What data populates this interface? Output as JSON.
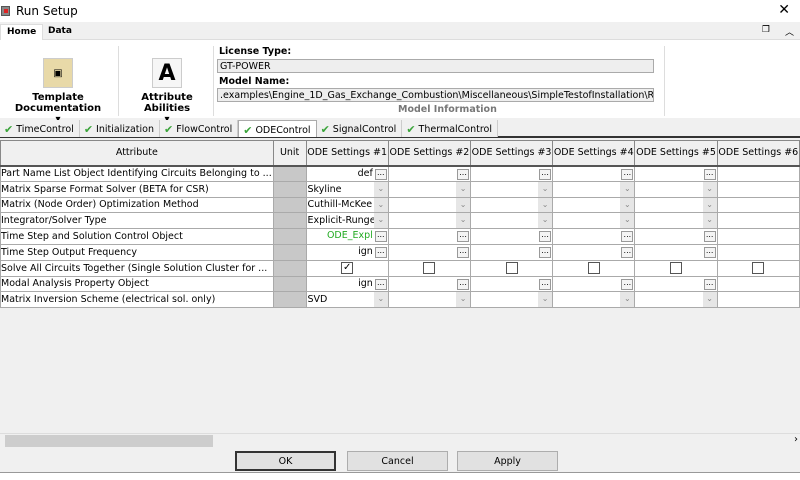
{
  "window": {
    "title": "Run Setup"
  },
  "ribbon": {
    "tabs": [
      "Home",
      "Data"
    ],
    "template_doc": "Template Documentation",
    "attr_abilities": "Attribute Abilities",
    "license_label": "License Type:",
    "license_value": "GT-POWER",
    "model_label": "Model Name:",
    "model_value": ".examples\\Engine_1D_Gas_Exchange_Combustion\\Miscellaneous\\SimpleTestofInstallation\\RunMeFirst.gtm",
    "group_label": "Model Information"
  },
  "tabs": [
    {
      "label": "TimeControl"
    },
    {
      "label": "Initialization"
    },
    {
      "label": "FlowControl"
    },
    {
      "label": "ODEControl",
      "active": true
    },
    {
      "label": "SignalControl"
    },
    {
      "label": "ThermalControl"
    }
  ],
  "accent": "#3aa43a",
  "table": {
    "headers": [
      "Attribute",
      "Unit",
      "ODE Settings #1",
      "ODE Settings #2",
      "ODE Settings #3",
      "ODE Settings #4",
      "ODE Settings #5",
      "ODE Settings #6"
    ],
    "rows": [
      {
        "attribute": "Part Name List Object Identifying Circuits Belonging to ...",
        "type": "object",
        "value": "def"
      },
      {
        "attribute": "Matrix Sparse Format Solver (BETA for CSR)",
        "type": "select",
        "value": "Skyline"
      },
      {
        "attribute": "Matrix (Node Order) Optimization Method",
        "type": "select",
        "value": "Cuthill-McKee"
      },
      {
        "attribute": "Integrator/Solver Type",
        "type": "select",
        "value": "Explicit-Runge..."
      },
      {
        "attribute": "Time Step and Solution Control Object",
        "type": "object",
        "value": "ODE_Expl",
        "value_color": "#22aa22"
      },
      {
        "attribute": "Time Step Output Frequency",
        "type": "object",
        "value": "ign"
      },
      {
        "attribute": "Solve All Circuits Together (Single Solution Cluster for ...",
        "type": "checkbox",
        "checked": true
      },
      {
        "attribute": "Modal Analysis Property Object",
        "type": "object",
        "value": "ign"
      },
      {
        "attribute": "Matrix Inversion Scheme (electrical sol. only)",
        "type": "select",
        "value": "SVD"
      }
    ]
  },
  "buttons": {
    "ok": "OK",
    "cancel": "Cancel",
    "apply": "Apply"
  }
}
